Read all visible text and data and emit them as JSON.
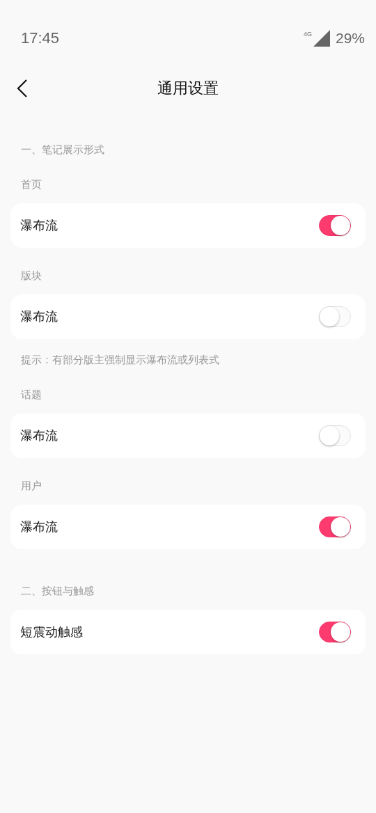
{
  "status_bar": {
    "time": "17:45",
    "network": "4G",
    "battery": "29%"
  },
  "header": {
    "title": "通用设置"
  },
  "sections": [
    {
      "title": "一、笔记展示形式",
      "items": [
        {
          "kind": "label",
          "text": "首页"
        },
        {
          "kind": "toggle",
          "text": "瀑布流",
          "on": true
        },
        {
          "kind": "label",
          "text": "版块"
        },
        {
          "kind": "toggle",
          "text": "瀑布流",
          "on": false
        },
        {
          "kind": "hint",
          "text": "提示：有部分版主强制显示瀑布流或列表式"
        },
        {
          "kind": "label",
          "text": "话题"
        },
        {
          "kind": "toggle",
          "text": "瀑布流",
          "on": false
        },
        {
          "kind": "label",
          "text": "用户"
        },
        {
          "kind": "toggle",
          "text": "瀑布流",
          "on": true
        }
      ]
    },
    {
      "title": "二、按钮与触感",
      "items": [
        {
          "kind": "toggle",
          "text": "短震动触感",
          "on": true
        }
      ]
    }
  ]
}
